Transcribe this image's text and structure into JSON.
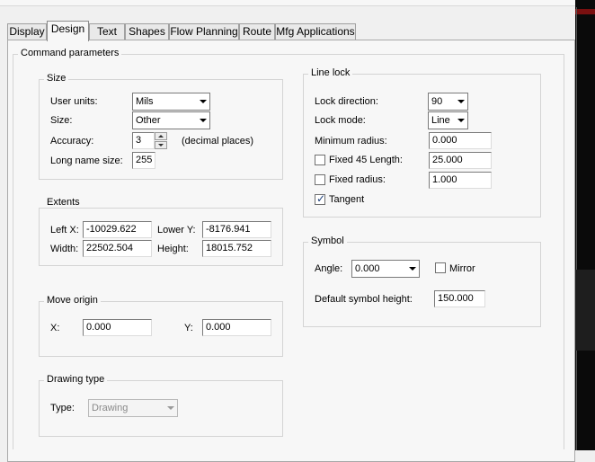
{
  "tabs": [
    {
      "label": "Display",
      "active": false
    },
    {
      "label": "Design",
      "active": true
    },
    {
      "label": "Text",
      "active": false
    },
    {
      "label": "Shapes",
      "active": false
    },
    {
      "label": "Flow Planning",
      "active": false
    },
    {
      "label": "Route",
      "active": false
    },
    {
      "label": "Mfg Applications",
      "active": false
    }
  ],
  "command_parameters": {
    "title": "Command parameters"
  },
  "size": {
    "title": "Size",
    "user_units_label": "User units:",
    "user_units_value": "Mils",
    "size_label": "Size:",
    "size_value": "Other",
    "accuracy_label": "Accuracy:",
    "accuracy_value": "3",
    "accuracy_suffix": "(decimal places)",
    "long_name_label": "Long name size:",
    "long_name_value": "255"
  },
  "extents": {
    "title": "Extents",
    "left_x_label": "Left X:",
    "left_x_value": "-10029.622",
    "lower_y_label": "Lower Y:",
    "lower_y_value": "-8176.941",
    "width_label": "Width:",
    "width_value": "22502.504",
    "height_label": "Height:",
    "height_value": "18015.752"
  },
  "move_origin": {
    "title": "Move origin",
    "x_label": "X:",
    "x_value": "0.000",
    "y_label": "Y:",
    "y_value": "0.000"
  },
  "drawing_type": {
    "title": "Drawing type",
    "type_label": "Type:",
    "type_value": "Drawing"
  },
  "line_lock": {
    "title": "Line lock",
    "lock_direction_label": "Lock direction:",
    "lock_direction_value": "90",
    "lock_mode_label": "Lock mode:",
    "lock_mode_value": "Line",
    "min_radius_label": "Minimum radius:",
    "min_radius_value": "0.000",
    "fixed45_label": "Fixed 45 Length:",
    "fixed45_value": "25.000",
    "fixed45_checked": false,
    "fixed_radius_label": "Fixed radius:",
    "fixed_radius_value": "1.000",
    "fixed_radius_checked": false,
    "tangent_label": "Tangent",
    "tangent_checked": true
  },
  "symbol": {
    "title": "Symbol",
    "angle_label": "Angle:",
    "angle_value": "0.000",
    "mirror_label": "Mirror",
    "mirror_checked": false,
    "default_height_label": "Default symbol height:",
    "default_height_value": "150.000"
  }
}
